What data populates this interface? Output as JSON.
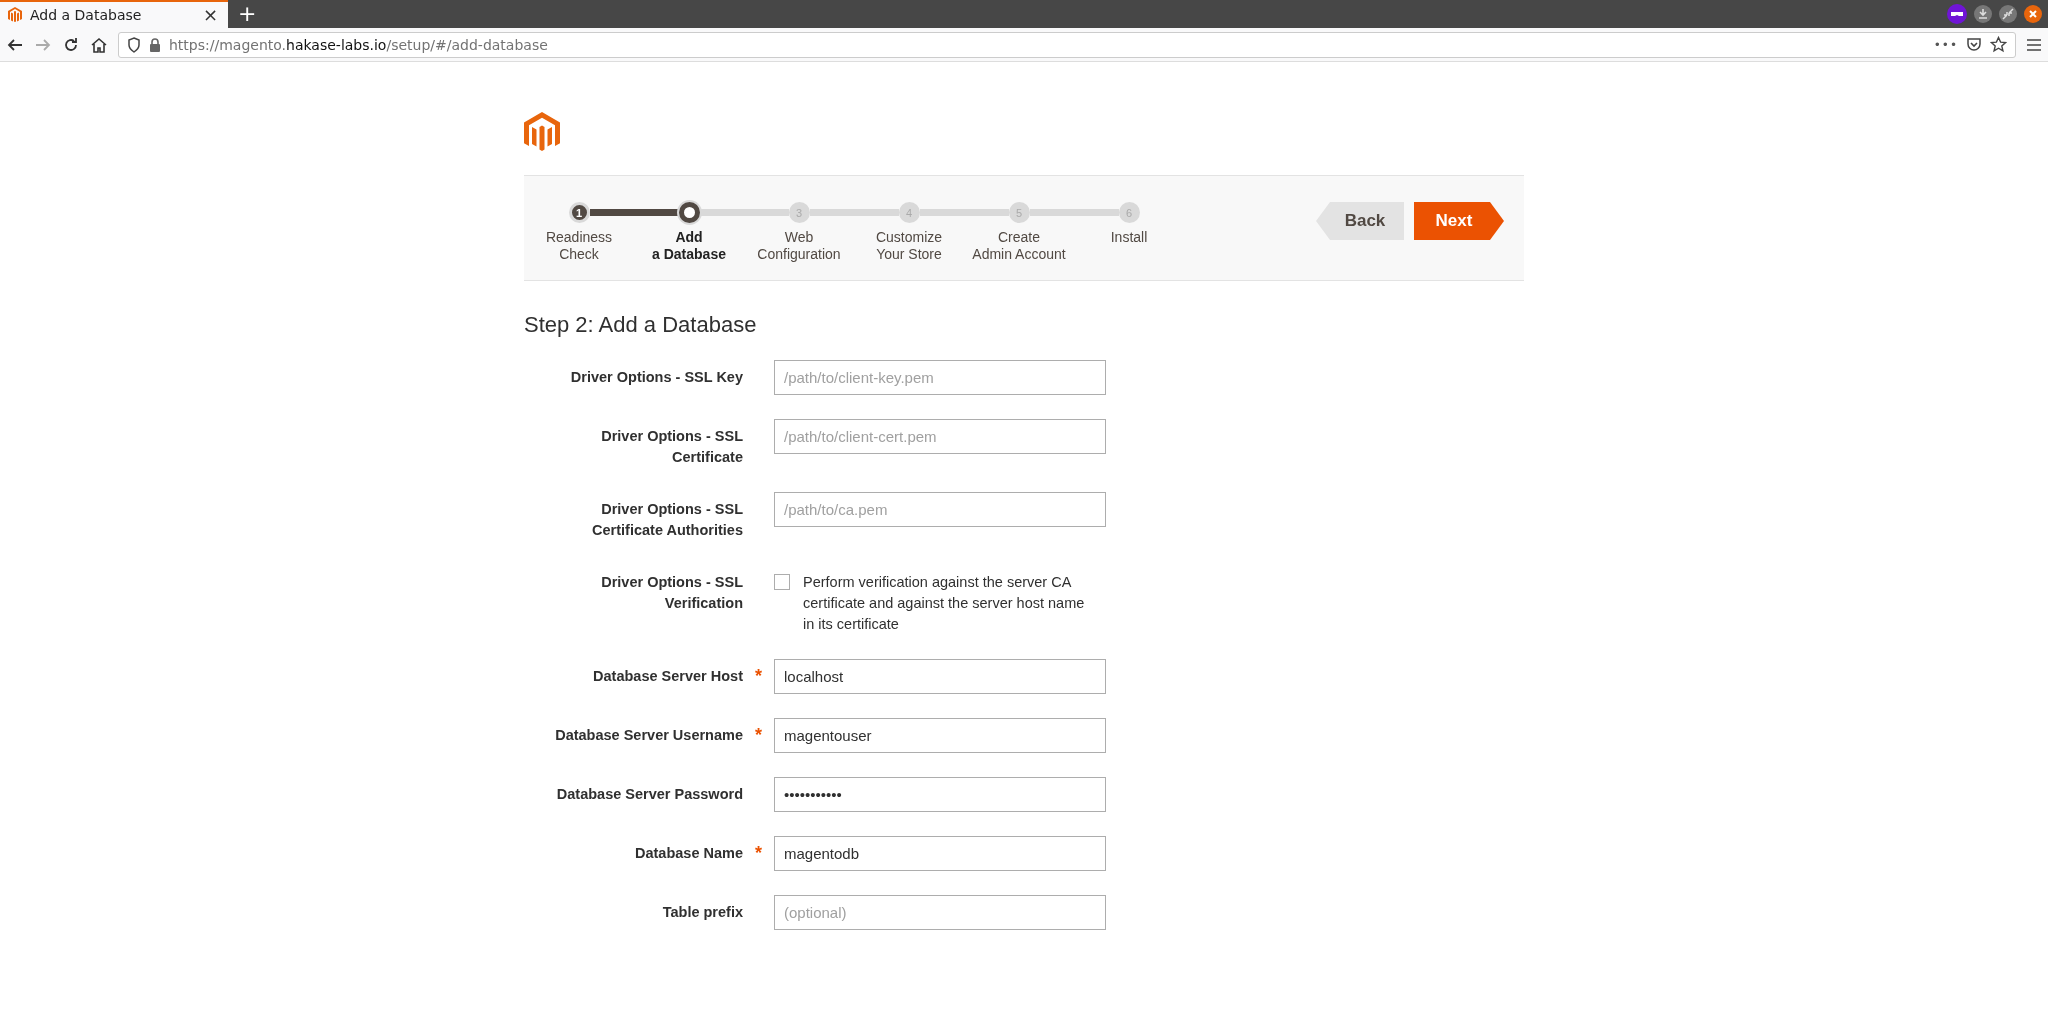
{
  "browser": {
    "tab_title": "Add a Database",
    "new_tab": "+",
    "close_tab": "×",
    "url": "https://magento.**hakase-labs.io**/setup/#/add-database",
    "page_actions": "•••"
  },
  "progress": {
    "steps": [
      {
        "number": "1",
        "label": "Readiness\nCheck",
        "done": true,
        "selected": false
      },
      {
        "label": "Add\na Database",
        "done": false,
        "selected": true
      },
      {
        "number": "3",
        "label": "Web\nConfiguration",
        "done": false,
        "selected": false
      },
      {
        "number": "4",
        "label": "Customize\nYour Store",
        "done": false,
        "selected": false
      },
      {
        "number": "5",
        "label": "Create\nAdmin Account",
        "done": false,
        "selected": false
      },
      {
        "number": "6",
        "label": "Install",
        "done": false,
        "selected": false
      }
    ],
    "buttons": [
      {
        "label": "Back",
        "kind": "back"
      },
      {
        "label": "Next",
        "kind": "next"
      }
    ]
  },
  "heading": "Step 2: Add a Database",
  "fields": [
    {
      "kind": "text",
      "label": "Driver Options - SSL Key",
      "placeholder": "/path/to/client-key.pem"
    },
    {
      "kind": "text",
      "label": "Driver Options - SSL Certificate",
      "placeholder": "/path/to/client-cert.pem"
    },
    {
      "kind": "text",
      "label": "Driver Options - SSL Certificate Authorities",
      "placeholder": "/path/to/ca.pem"
    },
    {
      "kind": "checkbox",
      "label": "Driver Options - SSL Verification",
      "checked": false,
      "text": "Perform verification against the server CA certificate and against the server host name in its certificate"
    },
    {
      "kind": "text",
      "label": "Database Server Host",
      "value": "localhost",
      "required_mark": "*"
    },
    {
      "kind": "text",
      "label": "Database Server Username",
      "value": "magentouser",
      "required_mark": "*"
    },
    {
      "kind": "text",
      "label": "Database Server Password",
      "value": "•••••••••••"
    },
    {
      "kind": "text",
      "label": "Database Name",
      "value": "magentodb",
      "required_mark": "*"
    },
    {
      "kind": "text",
      "label": "Table prefix",
      "placeholder": "(optional)"
    }
  ]
}
